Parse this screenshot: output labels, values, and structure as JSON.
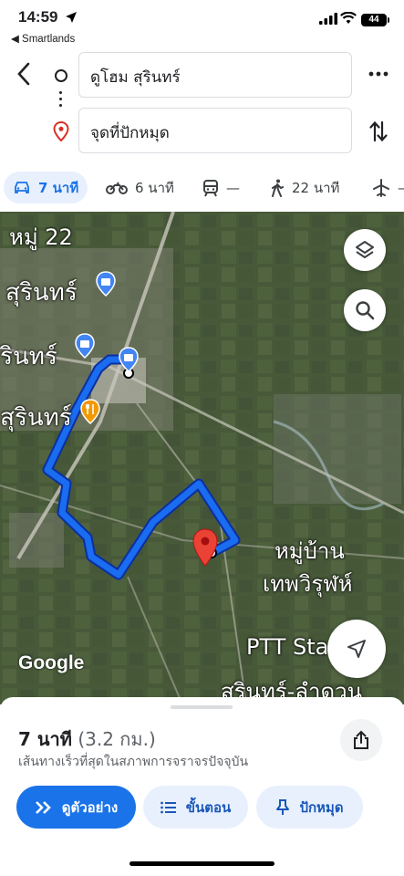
{
  "status": {
    "time": "14:59",
    "back_app": "◀ Smartlands",
    "battery": "44"
  },
  "search": {
    "origin": "ดูโฮม สุรินทร์",
    "destination": "จุดที่ปักหมุด"
  },
  "modes": [
    {
      "icon": "car-icon",
      "label": "7 นาที"
    },
    {
      "icon": "motorbike-icon",
      "label": "6 นาที"
    },
    {
      "icon": "transit-icon",
      "label": "—"
    },
    {
      "icon": "walk-icon",
      "label": "22 นาที"
    },
    {
      "icon": "flight-icon",
      "label": "—"
    }
  ],
  "map": {
    "labels": [
      "หมู่ 22",
      "สุรินทร์",
      "รินทร์",
      "สุรินทร์",
      "หมู่บ้าน",
      "เทพวิรุฬห์",
      "PTT Station",
      "สุรินทร์-ลำดวน"
    ],
    "attribution": "Google",
    "route_color": "#1a73e8",
    "pin_color": "#ea4335"
  },
  "sheet": {
    "duration": "7 นาที",
    "distance": "(3.2 กม.)",
    "subtitle": "เส้นทางเร็วที่สุดในสภาพการจราจรปัจจุบัน",
    "buttons": [
      "ดูตัวอย่าง",
      "ขั้นตอน",
      "ปักหมุด"
    ]
  }
}
